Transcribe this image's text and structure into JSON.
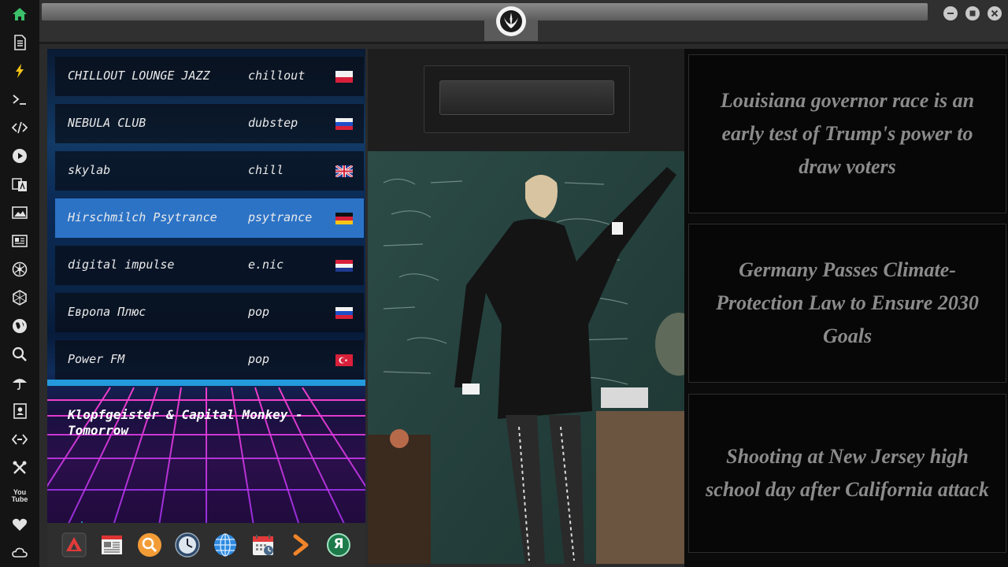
{
  "sidebar": {
    "icons": [
      "home-icon",
      "document-icon",
      "lightning-icon",
      "terminal-icon",
      "code-icon",
      "play-icon",
      "translate-icon",
      "image-icon",
      "news-icon",
      "rebel-icon",
      "hexagon-icon",
      "globe-icon",
      "search-icon",
      "umbrella-icon",
      "contacts-icon",
      "link-icon",
      "tools-icon",
      "youtube-icon",
      "heart-icon",
      "cloud-icon"
    ],
    "youtube_text": "You Tube"
  },
  "radio": {
    "stations": [
      {
        "name": "CHILLOUT LOUNGE JAZZ",
        "genre": "chillout",
        "flag": "poland",
        "active": false
      },
      {
        "name": "NEBULA CLUB",
        "genre": "dubstep",
        "flag": "russia",
        "active": false
      },
      {
        "name": "skylab",
        "genre": "chill",
        "flag": "uk",
        "active": false
      },
      {
        "name": "Hirschmilch Psytrance",
        "genre": "psytrance",
        "flag": "germany",
        "active": true
      },
      {
        "name": "digital impulse",
        "genre": "e.nic",
        "flag": "croatia",
        "active": false
      },
      {
        "name": "Европа Плюс",
        "genre": "pop",
        "flag": "russia",
        "active": false
      },
      {
        "name": "Power FM",
        "genre": "pop",
        "flag": "turkey",
        "active": false
      }
    ],
    "now_playing": "Klopfgeister & Capital Monkey - Tomorrow"
  },
  "dock": {
    "icons": [
      "app-launcher-icon",
      "news-reader-icon",
      "search-app-icon",
      "clock-icon",
      "browser-globe-icon",
      "calendar-icon",
      "forward-arrow-icon",
      "yandex-icon"
    ],
    "yandex_letter": "Я"
  },
  "news": {
    "items": [
      {
        "title": "Louisiana governor race is an early test of Trump's power to draw voters"
      },
      {
        "title": "Germany Passes Climate-Protection Law to Ensure 2030 Goals"
      },
      {
        "title": "Shooting at New Jersey high school day after California attack"
      }
    ]
  },
  "colors": {
    "accent": "#2c73c6",
    "home_icon": "#3cc06a",
    "lightning_icon": "#f5c518"
  }
}
